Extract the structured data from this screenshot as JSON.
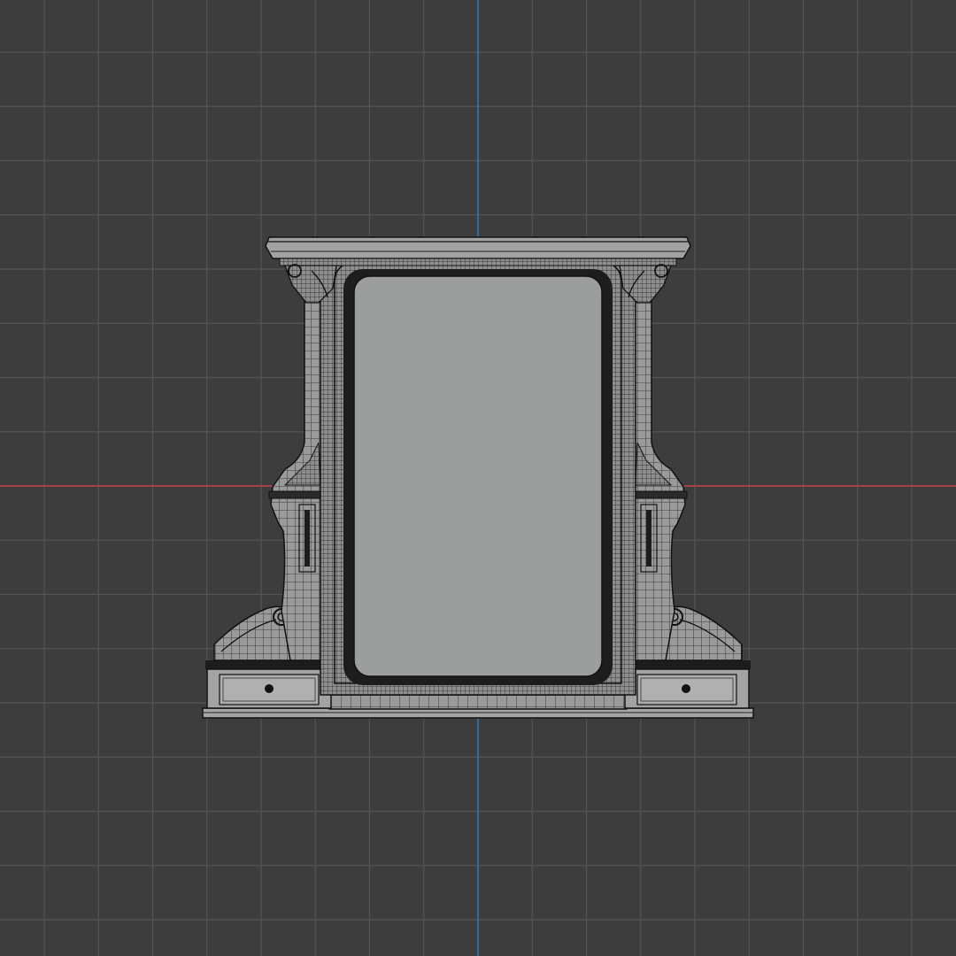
{
  "viewport": {
    "view": "front-orthographic",
    "shading": "wireframe-overlay",
    "colors": {
      "background": "#3d3d3d",
      "grid_major": "#555555",
      "x_axis": "#c0444c",
      "z_axis": "#3b74b8",
      "mesh_fill": "#9a9a9a",
      "mesh_wire": "#1a1a1a",
      "mirror_fill": "#9c9d9d"
    }
  },
  "object": {
    "name_semantic": "victorian-mantel-mirror",
    "parts": [
      "cornice",
      "frame",
      "mirror-glass",
      "left-pilaster",
      "right-pilaster",
      "left-shelf",
      "right-shelf",
      "left-drawer",
      "right-drawer",
      "base-plinth"
    ],
    "drawer_knob_icon": "knob-icon"
  }
}
